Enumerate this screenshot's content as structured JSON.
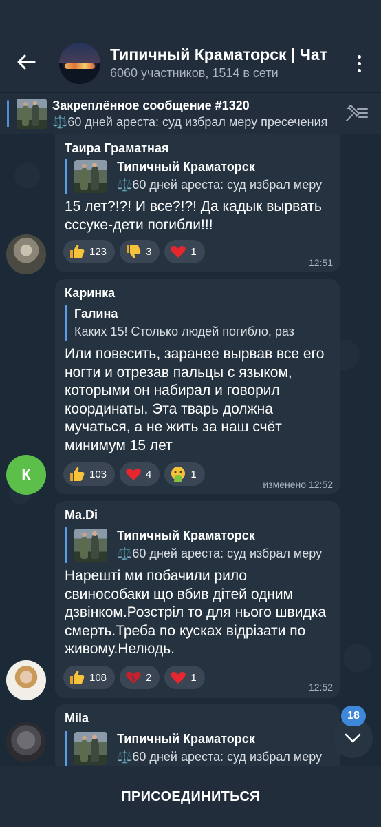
{
  "header": {
    "title": "Типичный Краматорск | Чат",
    "subtitle": "6060 участников, 1514 в сети"
  },
  "pinned": {
    "title": "Закреплённое сообщение #1320",
    "text": "⚖️60 дней ареста: суд избрал меру пресечения"
  },
  "messages": [
    {
      "author": "Таира Граматная",
      "author_color": "#ffffff",
      "reply_name": "Типичный Краматорск",
      "reply_text": "⚖️60 дней ареста: суд избрал меру",
      "text": "15 лет?!?! И все?!?! Да кадык вырвать сссуке-дети погибли!!!",
      "reactions": [
        {
          "emoji": "thumbs-up",
          "count": "123"
        },
        {
          "emoji": "thumbs-down",
          "count": "3"
        },
        {
          "emoji": "heart",
          "count": "1"
        }
      ],
      "time": "12:51"
    },
    {
      "author": "Каринка",
      "author_color": "#ffffff",
      "reply_name": "Галина",
      "reply_text": "Каких 15! Столько людей погибло, раз",
      "text": "Или повесить, заранее вырвав все его ногти и отрезав пальцы с языком, которыми он набирал и говорил координаты. Эта тварь должна мучаться, а не жить за наш счёт минимум 15 лет",
      "reactions": [
        {
          "emoji": "thumbs-up",
          "count": "103"
        },
        {
          "emoji": "heart",
          "count": "4"
        },
        {
          "emoji": "vomit",
          "count": "1"
        }
      ],
      "time": "изменено 12:52",
      "avatar_letter": "К"
    },
    {
      "author": "Ma.Di",
      "author_color": "#ffffff",
      "reply_name": "Типичный Краматорск",
      "reply_text": "⚖️60 дней ареста: суд избрал меру",
      "text": "Нарешті ми побачили рило свинособаки що вбив дітей одним дзвінком.Розстріл то для нього швидка смерть.Треба по кусках відрізати по живому.Нелюдь.",
      "reactions": [
        {
          "emoji": "thumbs-up",
          "count": "108"
        },
        {
          "emoji": "broken-heart",
          "count": "2"
        },
        {
          "emoji": "heart",
          "count": "1"
        }
      ],
      "time": "12:52"
    },
    {
      "author": "Mila",
      "author_color": "#ffffff",
      "reply_name": "Типичный Краматорск",
      "reply_text": "⚖️60 дней ареста: суд избрал меру"
    }
  ],
  "unread_count": "18",
  "join_label": "ПРИСОЕДИНИТЬСЯ",
  "colors": {
    "accent": "#5a9ee8",
    "bubble": "#253340",
    "background": "#1c2a38",
    "header": "#212d3b",
    "badge": "#3d88d8"
  }
}
